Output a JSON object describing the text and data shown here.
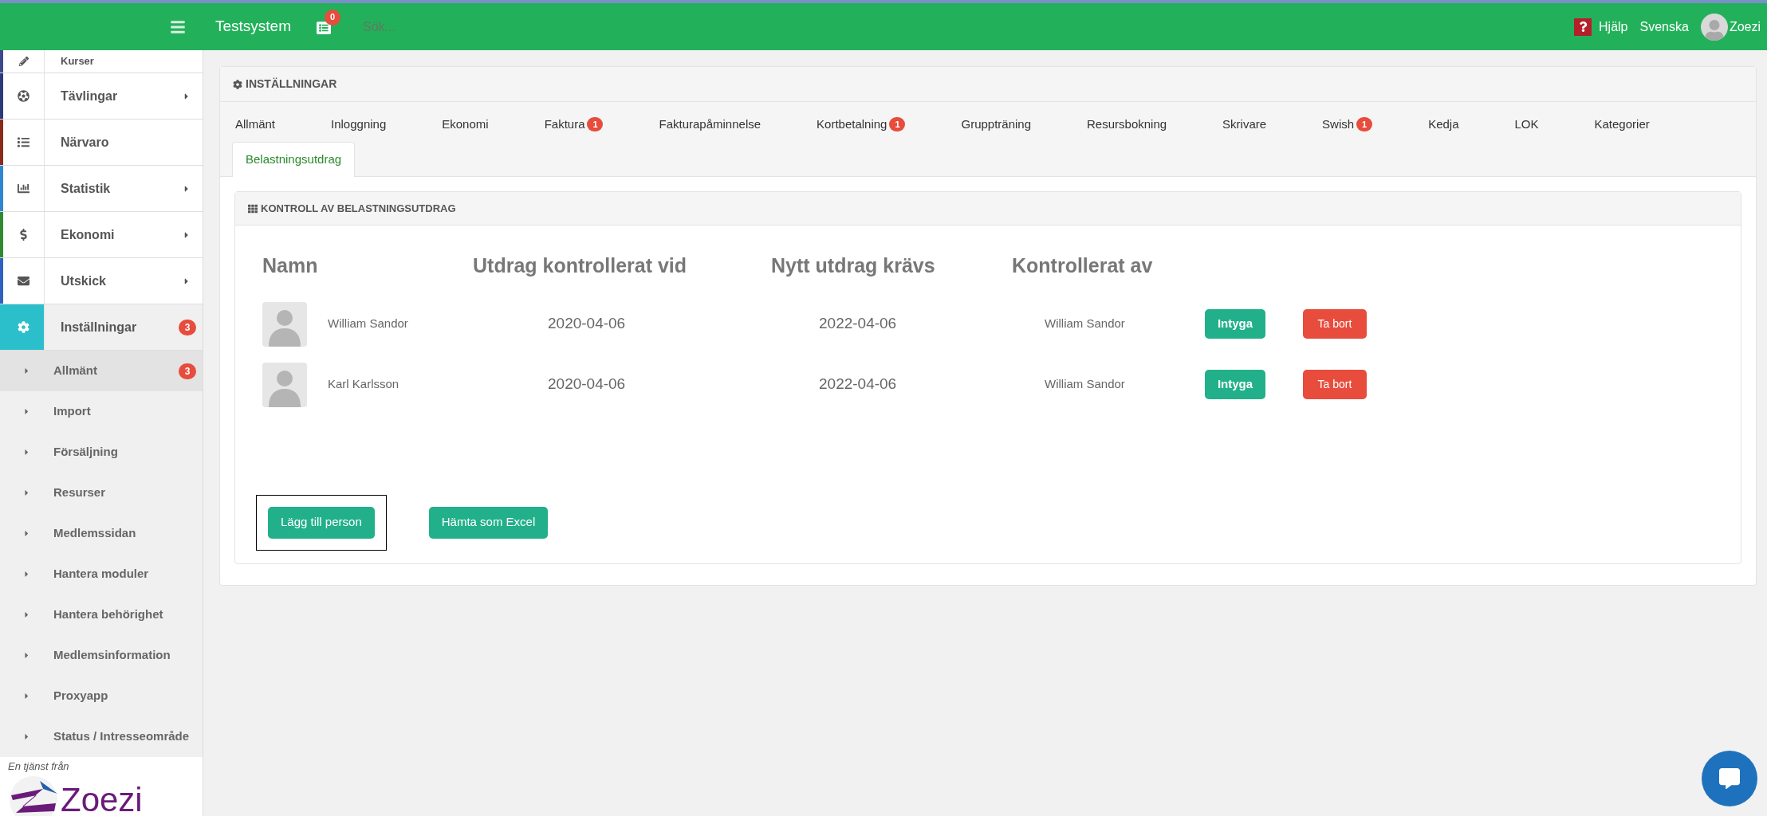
{
  "topbar": {
    "app_name": "Testsystem",
    "notification_count": "0",
    "search": {
      "placeholder": "Sök..."
    },
    "help": "Hjälp",
    "language": "Svenska",
    "user": "Zoezi"
  },
  "sidebar": {
    "items": [
      {
        "label": "Kurser",
        "color": "#3b4a8c",
        "has_arrow": false,
        "expanded": false
      },
      {
        "label": "Tävlingar",
        "color": "#2a3a7a",
        "has_arrow": true,
        "expanded": false
      },
      {
        "label": "Närvaro",
        "color": "#8b2a1a",
        "has_arrow": false,
        "expanded": false
      },
      {
        "label": "Statistik",
        "color": "#2f86d0",
        "has_arrow": true,
        "expanded": false
      },
      {
        "label": "Ekonomi",
        "color": "#2f8a2f",
        "has_arrow": true,
        "expanded": false
      },
      {
        "label": "Utskick",
        "color": "#2f62c0",
        "has_arrow": true,
        "expanded": false
      },
      {
        "label": "Inställningar",
        "color": "#2bbfcb",
        "has_arrow": false,
        "badge": "3",
        "expanded": true,
        "children": [
          {
            "label": "Allmänt",
            "badge": "3",
            "selected": true
          },
          {
            "label": "Import",
            "selected": false
          },
          {
            "label": "Försäljning",
            "selected": false
          },
          {
            "label": "Resurser",
            "selected": false
          },
          {
            "label": "Medlemssidan",
            "selected": false
          },
          {
            "label": "Hantera moduler",
            "selected": false
          },
          {
            "label": "Hantera behörighet",
            "selected": false
          },
          {
            "label": "Medlemsinformation",
            "selected": false
          },
          {
            "label": "Proxyapp",
            "selected": false
          },
          {
            "label": "Status / Intresseområde",
            "selected": false
          }
        ]
      }
    ],
    "footer": {
      "caption": "En tjänst från",
      "logo_text": "Zoezi"
    }
  },
  "settings": {
    "title": "INSTÄLLNINGAR",
    "tabs": [
      {
        "label": "Allmänt",
        "selected": false
      },
      {
        "label": "Inloggning",
        "selected": false
      },
      {
        "label": "Ekonomi",
        "selected": false
      },
      {
        "label": "Faktura",
        "badge": "1",
        "selected": false
      },
      {
        "label": "Fakturapåminnelse",
        "selected": false
      },
      {
        "label": "Kortbetalning",
        "badge": "1",
        "selected": false
      },
      {
        "label": "Gruppträning",
        "selected": false
      },
      {
        "label": "Resursbokning",
        "selected": false
      },
      {
        "label": "Skrivare",
        "selected": false
      },
      {
        "label": "Swish",
        "badge": "1",
        "selected": false
      },
      {
        "label": "Kedja",
        "selected": false
      },
      {
        "label": "LOK",
        "selected": false
      },
      {
        "label": "Kategorier",
        "selected": false
      },
      {
        "label": "Belastningsutdrag",
        "selected": true
      }
    ],
    "panel": {
      "title": "KONTROLL AV BELASTNINGSUTDRAG",
      "columns": [
        "Namn",
        "Utdrag kontrollerat vid",
        "Nytt utdrag krävs",
        "Kontrollerat av"
      ],
      "rows": [
        {
          "name": "William Sandor",
          "checked_on": "2020-04-06",
          "new_required": "2022-04-06",
          "checked_by": "William Sandor",
          "confirm": "Intyga",
          "remove": "Ta bort"
        },
        {
          "name": "Karl Karlsson",
          "checked_on": "2020-04-06",
          "new_required": "2022-04-06",
          "checked_by": "William Sandor",
          "confirm": "Intyga",
          "remove": "Ta bort"
        }
      ],
      "buttons": [
        {
          "label": "Lägg till person",
          "focused": true
        },
        {
          "label": "Hämta som Excel",
          "focused": false
        }
      ]
    }
  }
}
